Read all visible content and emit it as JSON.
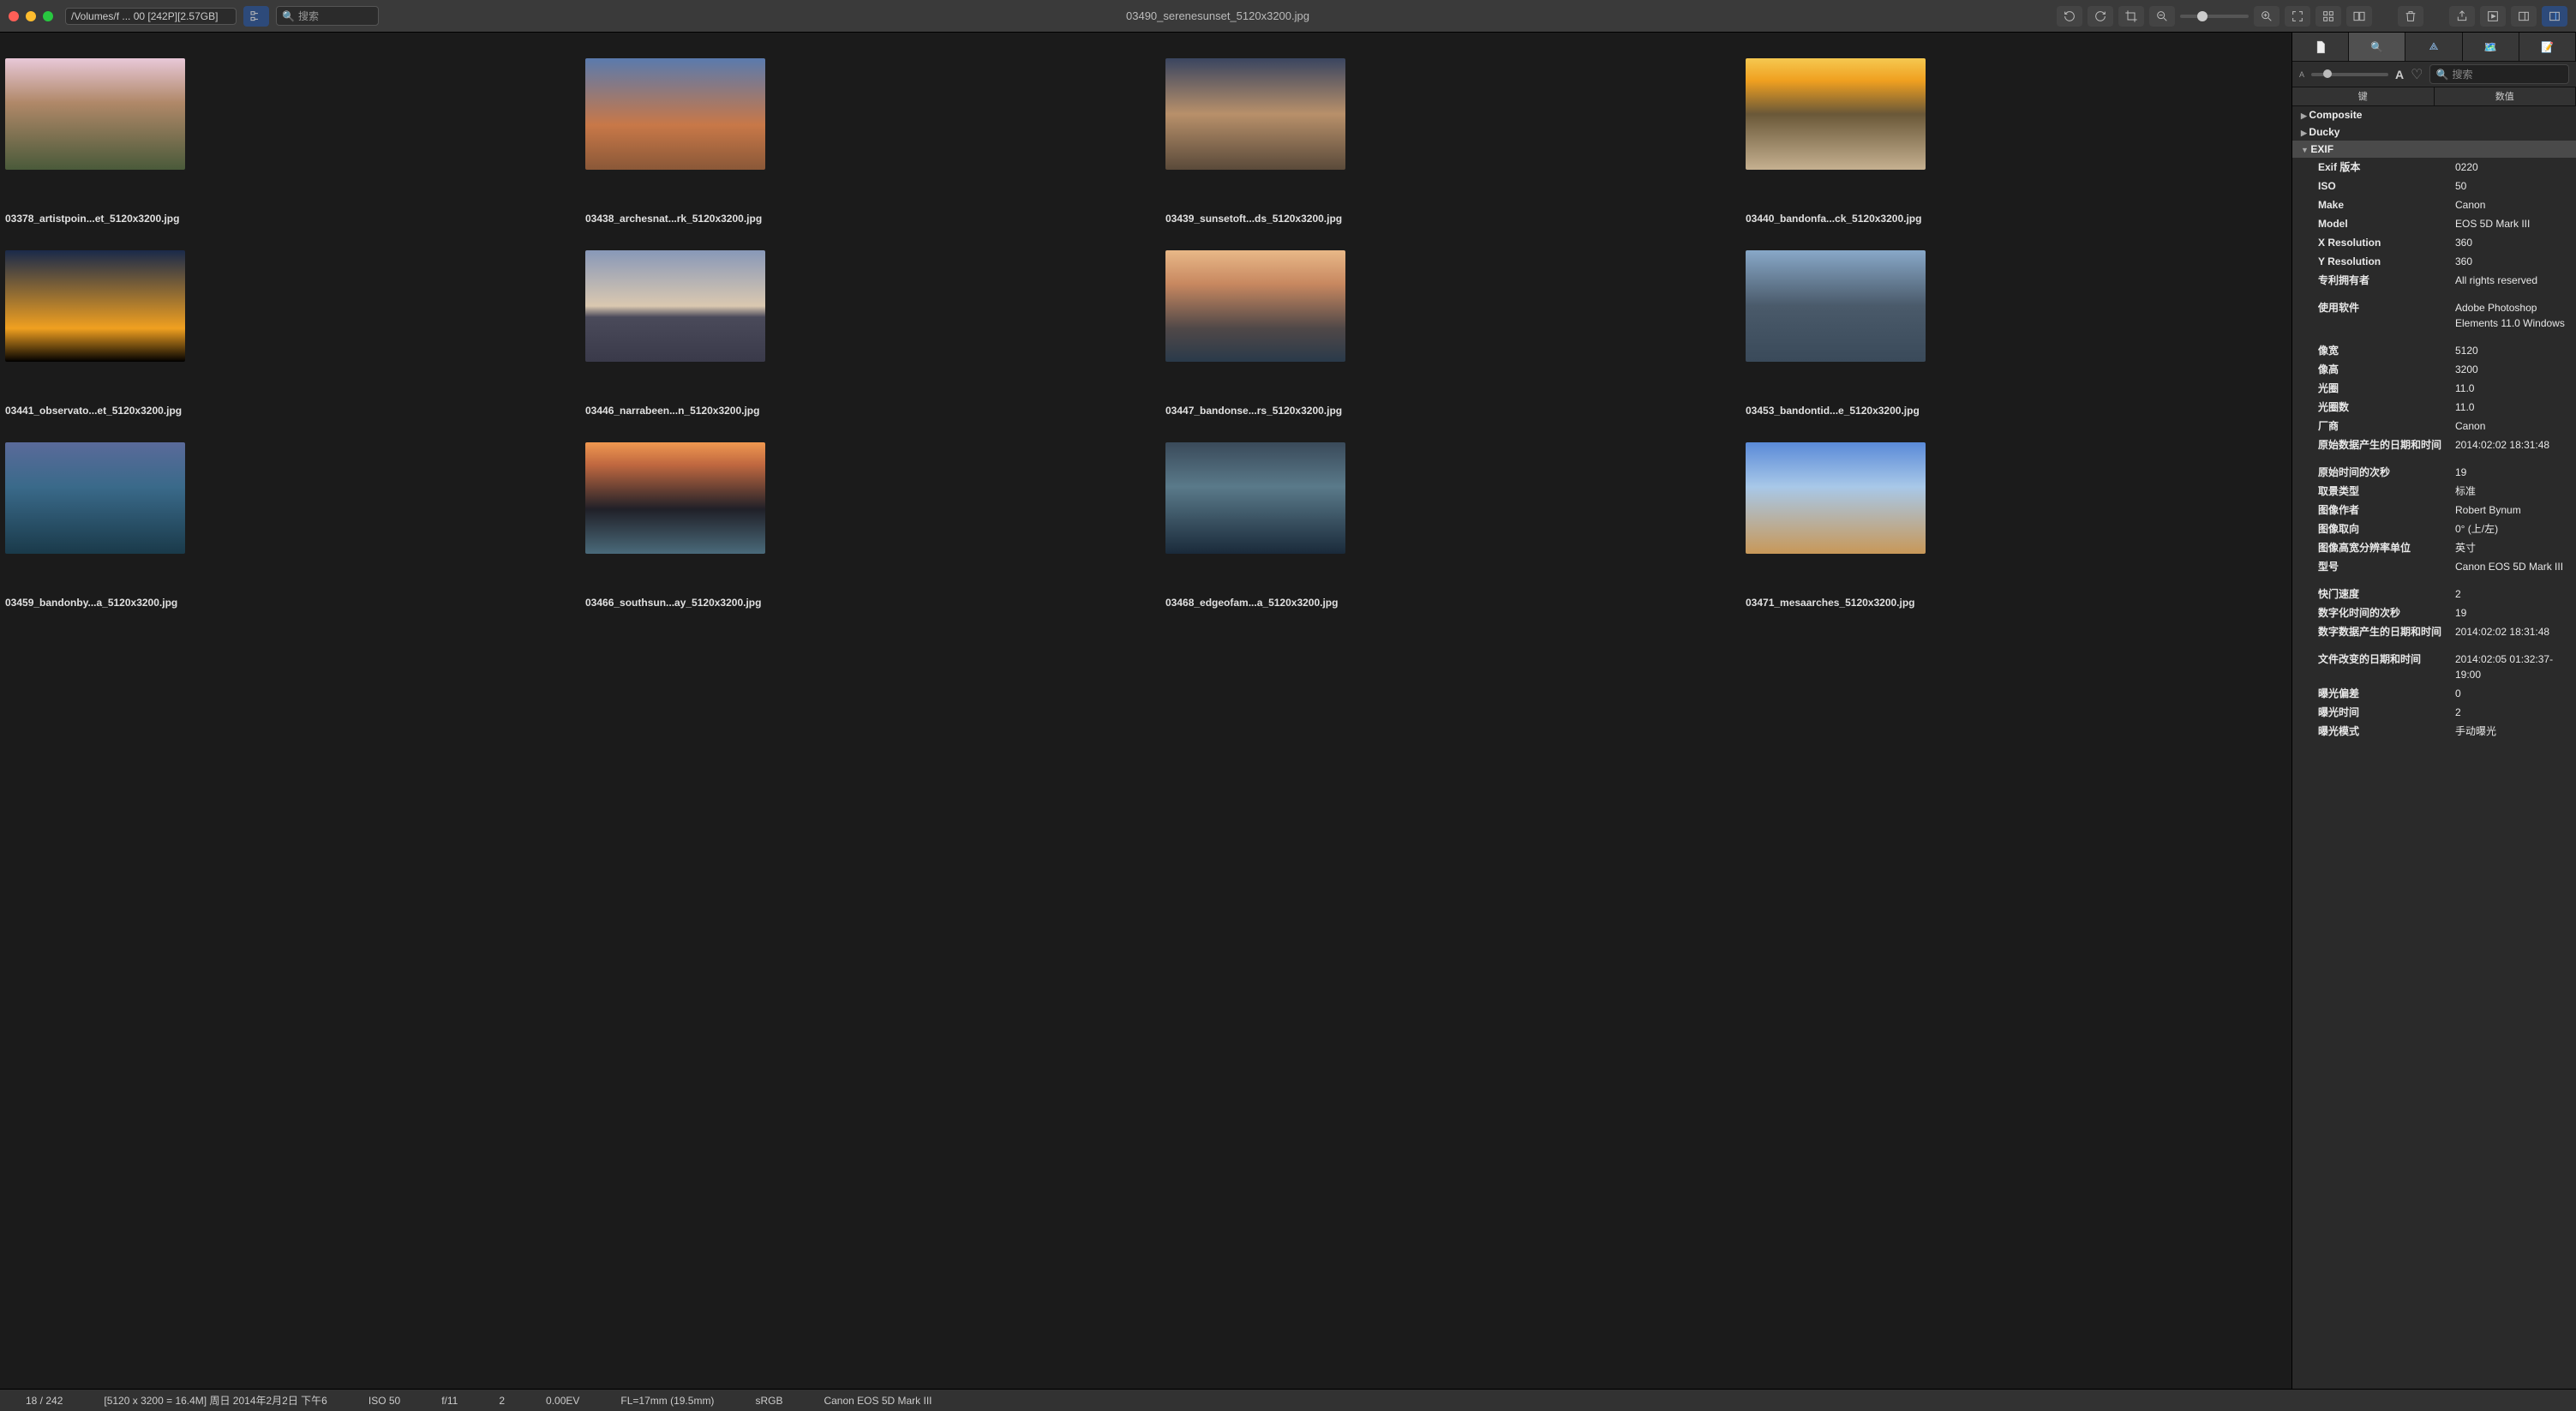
{
  "titlebar": {
    "path": "/Volumes/f ... 00 [242P][2.57GB]",
    "search_placeholder": "搜索",
    "current_file": "03490_serenesunset_5120x3200.jpg"
  },
  "thumbnails": [
    {
      "caption": "03378_artistpoin...et_5120x3200.jpg"
    },
    {
      "caption": "03438_archesnat...rk_5120x3200.jpg"
    },
    {
      "caption": "03439_sunsetoft...ds_5120x3200.jpg"
    },
    {
      "caption": "03440_bandonfa...ck_5120x3200.jpg"
    },
    {
      "caption": "03441_observato...et_5120x3200.jpg"
    },
    {
      "caption": "03446_narrabeen...n_5120x3200.jpg"
    },
    {
      "caption": "03447_bandonse...rs_5120x3200.jpg"
    },
    {
      "caption": "03453_bandontid...e_5120x3200.jpg"
    },
    {
      "caption": "03459_bandonby...a_5120x3200.jpg"
    },
    {
      "caption": "03466_southsun...ay_5120x3200.jpg"
    },
    {
      "caption": "03468_edgeofam...a_5120x3200.jpg"
    },
    {
      "caption": "03471_mesaarches_5120x3200.jpg"
    }
  ],
  "inspector": {
    "header_key": "键",
    "header_value": "数值",
    "search_placeholder": "搜索",
    "sections": {
      "composite": "Composite",
      "ducky": "Ducky",
      "exif": "EXIF"
    },
    "exif": [
      {
        "k": "Exif 版本",
        "v": "0220"
      },
      {
        "k": "ISO",
        "v": "50"
      },
      {
        "k": "Make",
        "v": "Canon"
      },
      {
        "k": "Model",
        "v": "EOS 5D Mark III"
      },
      {
        "k": "X Resolution",
        "v": "360"
      },
      {
        "k": "Y Resolution",
        "v": "360"
      },
      {
        "k": "专利拥有者",
        "v": "All rights reserved"
      },
      {
        "spacer": true
      },
      {
        "k": "使用软件",
        "v": "Adobe Photoshop Elements 11.0 Windows"
      },
      {
        "spacer": true
      },
      {
        "k": "像宽",
        "v": "5120"
      },
      {
        "k": "像高",
        "v": "3200"
      },
      {
        "k": "光圈",
        "v": "11.0"
      },
      {
        "k": "光圈数",
        "v": "11.0"
      },
      {
        "k": "厂商",
        "v": "Canon"
      },
      {
        "k": "原始数据产生的日期和时间",
        "v": "2014:02:02 18:31:48"
      },
      {
        "spacer": true
      },
      {
        "k": "原始时间的次秒",
        "v": "19"
      },
      {
        "k": "取景类型",
        "v": "标准"
      },
      {
        "k": "图像作者",
        "v": "Robert Bynum"
      },
      {
        "k": "图像取向",
        "v": "0° (上/左)"
      },
      {
        "k": "图像高宽分辨率单位",
        "v": "英寸"
      },
      {
        "k": "型号",
        "v": "Canon EOS 5D Mark III"
      },
      {
        "spacer": true
      },
      {
        "k": "快门速度",
        "v": "2"
      },
      {
        "k": "数字化时间的次秒",
        "v": "19"
      },
      {
        "k": "数字数据产生的日期和时间",
        "v": "2014:02:02 18:31:48"
      },
      {
        "spacer": true
      },
      {
        "k": "文件改变的日期和时间",
        "v": "2014:02:05 01:32:37-19:00"
      },
      {
        "k": "曝光偏差",
        "v": "0"
      },
      {
        "k": "曝光时间",
        "v": "2"
      },
      {
        "k": "曝光模式",
        "v": "手动曝光"
      }
    ]
  },
  "status": {
    "index": "18 / 242",
    "dims": "[5120 x 3200 = 16.4M] 周日 2014年2月2日  下午6",
    "iso": "ISO 50",
    "f": "f/11",
    "shutter": "2",
    "ev": "0.00EV",
    "fl": "FL=17mm (19.5mm)",
    "cs": "sRGB",
    "cam": "Canon EOS 5D Mark III"
  }
}
